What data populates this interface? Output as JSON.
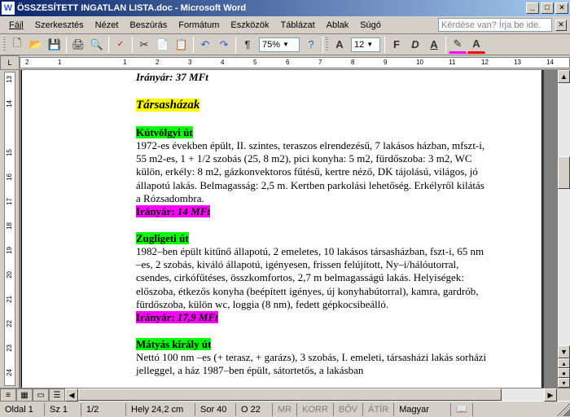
{
  "title": "ÖSSZESÍTETT INGATLAN LISTA.doc - Microsoft Word",
  "menu": [
    "Fájl",
    "Szerkesztés",
    "Nézet",
    "Beszúrás",
    "Formátum",
    "Eszközök",
    "Táblázat",
    "Ablak",
    "Súgó"
  ],
  "ask_placeholder": "Kérdése van? Írja be ide.",
  "zoom": "75%",
  "font_size": "12",
  "ruler_h": [
    "2",
    "1",
    "",
    "1",
    "2",
    "3",
    "4",
    "5",
    "6",
    "7",
    "8",
    "9",
    "10",
    "11",
    "12",
    "13",
    "14"
  ],
  "ruler_v": [
    "13",
    "14",
    "",
    "15",
    "16",
    "17",
    "18",
    "19",
    "20",
    "21",
    "22",
    "23",
    "24"
  ],
  "doc": {
    "trunc_top": "Irányár: 37 MFt",
    "section": "Társasházak",
    "item1": {
      "title": "Kútvölgyi út",
      "body": "1972-es években épült, II. szintes, teraszos elrendezésű, 7 lakásos házban, mfszt-i, 55 m2-es, 1 + 1/2 szobás (25, 8 m2), pici konyha: 5 m2, fürdőszoba: 3 m2, WC külön, erkély: 8 m2, gázkonvektoros fűtésű, kertre néző, DK tájolású, világos, jó állapotú lakás. Belmagasság: 2,5 m. Kertben parkolási lehetőség. Erkélyről kilátás a Rózsadombra.",
      "price_label": "Irányár:",
      "price_value": " 14 MFt"
    },
    "item2": {
      "title": "Zugligeti út",
      "body": "1982–ben épült kitűnő állapotú, 2 emeletes, 10 lakásos társasházban, fszt-i, 65 nm –es, 2 szobás, kiváló állapotú, igényesen, frissen felújított, Ny–i/hálóutorral, csendes, cirkófűtéses, összkomfortos, 2,7 m belmagasságú lakás. Helyiségek: előszoba, étkezős konyha (beépített igényes, új konyhabútorral), kamra, gardrób, fürdőszoba, külön wc, loggia (8 nm), fedett gépkocsibeálló.",
      "price_label": "Irányár:",
      "price_value": " 17,9 MFt"
    },
    "item3": {
      "title": "Mátyás király út",
      "body": "Nettó 100 nm –es (+ terasz, + garázs), 3 szobás, I. emeleti, társasházi lakás sorházi jelleggel, a ház 1987–ben épült, sátortetős, a lakásban"
    }
  },
  "status": {
    "page": "Oldal 1",
    "section": "Sz 1",
    "pages": "1/2",
    "pos": "Hely 24,2 cm",
    "line": "Sor 40",
    "col": "O 22",
    "modes": [
      "MR",
      "KORR",
      "BŐV",
      "ÁTÍR"
    ],
    "lang": "Magyar"
  }
}
